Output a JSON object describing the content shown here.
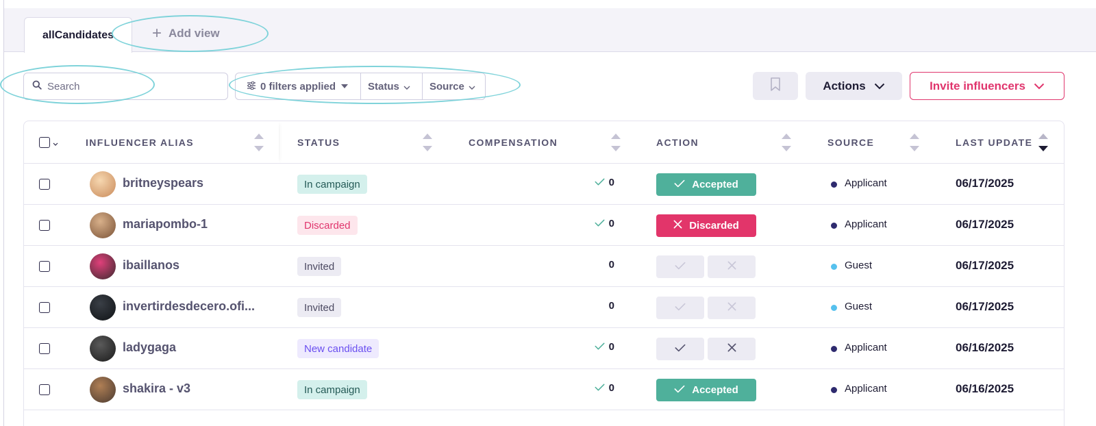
{
  "tabs": {
    "active": "allCandidates",
    "add_view": "Add view"
  },
  "toolbar": {
    "search_placeholder": "Search",
    "filters_label": "0 filters applied",
    "status_filter": "Status",
    "source_filter": "Source",
    "actions_label": "Actions",
    "invite_label": "Invite influencers"
  },
  "table": {
    "columns": {
      "alias": "INFLUENCER ALIAS",
      "status": "STATUS",
      "compensation": "COMPENSATION",
      "action": "ACTION",
      "source": "SOURCE",
      "last_update": "LAST UPDATE"
    },
    "sort_column": "LAST UPDATE",
    "sort_direction": "descending",
    "rows": [
      {
        "alias": "britneyspears",
        "status": "In campaign",
        "status_kind": "campaign",
        "compensation": "0",
        "comp_check": true,
        "action_state": "accepted",
        "action_label": "Accepted",
        "source": "Applicant",
        "last_update": "06/17/2025"
      },
      {
        "alias": "mariapombo-1",
        "status": "Discarded",
        "status_kind": "discarded",
        "compensation": "0",
        "comp_check": true,
        "action_state": "discarded",
        "action_label": "Discarded",
        "source": "Applicant",
        "last_update": "06/17/2025"
      },
      {
        "alias": "ibaillanos",
        "status": "Invited",
        "status_kind": "invited",
        "compensation": "0",
        "comp_check": false,
        "action_state": "disabled",
        "action_label": "",
        "source": "Guest",
        "last_update": "06/17/2025"
      },
      {
        "alias": "invertirdesdecero.ofi...",
        "status": "Invited",
        "status_kind": "invited",
        "compensation": "0",
        "comp_check": false,
        "action_state": "disabled",
        "action_label": "",
        "source": "Guest",
        "last_update": "06/17/2025"
      },
      {
        "alias": "ladygaga",
        "status": "New candidate",
        "status_kind": "new",
        "compensation": "0",
        "comp_check": true,
        "action_state": "pending",
        "action_label": "",
        "source": "Applicant",
        "last_update": "06/16/2025"
      },
      {
        "alias": "shakira - v3",
        "status": "In campaign",
        "status_kind": "campaign",
        "compensation": "0",
        "comp_check": true,
        "action_state": "accepted",
        "action_label": "Accepted",
        "source": "Applicant",
        "last_update": "06/16/2025"
      }
    ]
  },
  "colors": {
    "accent_pink": "#e0356d",
    "accepted_green": "#4fb09b",
    "source_applicant": "#2e2a6e",
    "source_guest": "#56c1ee",
    "annotation": "#7fd3da"
  }
}
